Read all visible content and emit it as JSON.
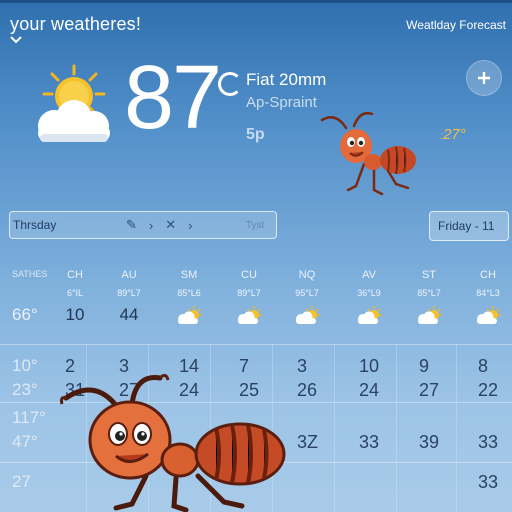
{
  "header": {
    "title": "your weatheres!",
    "forecast_link": "Weatlday Forecast",
    "add_icon": "plus-icon"
  },
  "current": {
    "temperature": "87",
    "condition_line1": "Fiat 20mm",
    "condition_line2": "Ap-Spraint",
    "small_text": "5p",
    "side_reading": "27"
  },
  "day_bar": {
    "label": "Thrsday",
    "end_text": "Tyst"
  },
  "day_select": {
    "value": "Friday",
    "suffix": "- 11"
  },
  "grid": {
    "row_label_day": "SATHES",
    "row_label_temp": "66°",
    "days": [
      "CH",
      "AU",
      "SM",
      "CU",
      "NQ",
      "AV",
      "ST",
      "CH"
    ],
    "codes": [
      "6°IL",
      "89°L7",
      "85°L6",
      "89°L7",
      "95°L7",
      "36°L9",
      "85°L7",
      "84°L3"
    ],
    "row1_values": [
      "10",
      "44",
      "",
      "",
      "",
      "",
      "",
      ""
    ],
    "row1_weather_icons": [
      "",
      "",
      "partly-cloudy-icon",
      "partly-cloudy-icon",
      "partly-cloudy-icon",
      "partly-cloudy-icon",
      "partly-cloudy-icon",
      "partly-cloudy-icon"
    ]
  },
  "table_rows": [
    {
      "label": "10°",
      "values": [
        "2",
        "3",
        "14",
        "7",
        "3",
        "10",
        "9",
        "8"
      ]
    },
    {
      "label": "23°",
      "values": [
        "31",
        "27",
        "24",
        "25",
        "26",
        "24",
        "27",
        "22"
      ]
    },
    {
      "label": "117°",
      "values": [
        "",
        "",
        "",
        "",
        "",
        "",
        "",
        ""
      ]
    },
    {
      "label": "47°",
      "values": [
        "",
        "",
        "",
        "",
        "3Z",
        "33",
        "39",
        "33"
      ]
    },
    {
      "label": "27",
      "values": [
        "",
        "",
        "",
        "",
        "",
        "",
        "",
        "33"
      ]
    }
  ]
}
